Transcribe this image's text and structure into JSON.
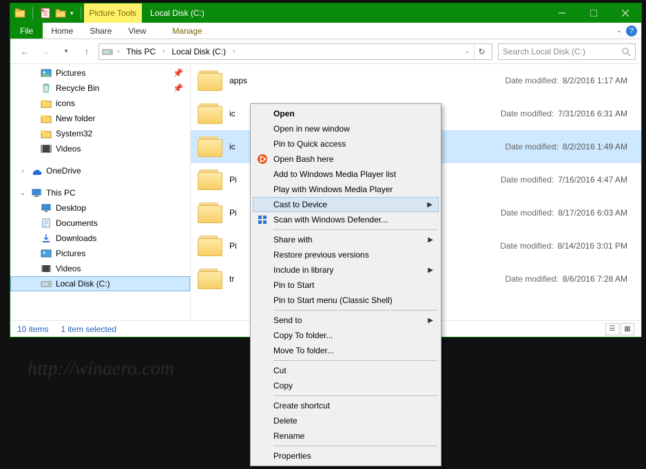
{
  "title": "Local Disk (C:)",
  "picture_tools": "Picture Tools",
  "ribbon": {
    "file": "File",
    "home": "Home",
    "share": "Share",
    "view": "View",
    "manage": "Manage"
  },
  "breadcrumb": {
    "pc": "This PC",
    "drive": "Local Disk (C:)"
  },
  "search_placeholder": "Search Local Disk (C:)",
  "nav": {
    "pictures": "Pictures",
    "recycle": "Recycle Bin",
    "icons_folder": "icons",
    "newfolder": "New folder",
    "system32": "System32",
    "videos": "Videos",
    "onedrive": "OneDrive",
    "thispc": "This PC",
    "desktop": "Desktop",
    "documents": "Documents",
    "downloads": "Downloads",
    "pictures2": "Pictures",
    "videos2": "Videos",
    "localdisk": "Local Disk (C:)"
  },
  "files": [
    {
      "name": "apps",
      "date": "8/2/2016 1:17 AM"
    },
    {
      "name": "ic",
      "date": "7/31/2016 6:31 AM"
    },
    {
      "name": "ic",
      "date": "8/2/2016 1:49 AM"
    },
    {
      "name": "Pi",
      "date": "7/16/2016 4:47 AM"
    },
    {
      "name": "Pi",
      "date": "8/17/2016 6:03 AM"
    },
    {
      "name": "Pi",
      "date": "8/14/2016 3:01 PM"
    },
    {
      "name": "tr",
      "date": "8/6/2016 7:28 AM"
    }
  ],
  "date_label": "Date modified:",
  "status": {
    "count": "10 items",
    "selected": "1 item selected"
  },
  "ctx": {
    "open": "Open",
    "opennew": "Open in new window",
    "pinqa": "Pin to Quick access",
    "bash": "Open Bash here",
    "wmpadd": "Add to Windows Media Player list",
    "wmpplay": "Play with Windows Media Player",
    "cast": "Cast to Device",
    "defender": "Scan with Windows Defender...",
    "sharewith": "Share with",
    "restore": "Restore previous versions",
    "includelib": "Include in library",
    "pinstart": "Pin to Start",
    "pinclassic": "Pin to Start menu (Classic Shell)",
    "sendto": "Send to",
    "copyto": "Copy To folder...",
    "moveto": "Move To folder...",
    "cut": "Cut",
    "copy": "Copy",
    "shortcut": "Create shortcut",
    "delete": "Delete",
    "rename": "Rename",
    "properties": "Properties"
  },
  "watermark": "http://winaero.com"
}
